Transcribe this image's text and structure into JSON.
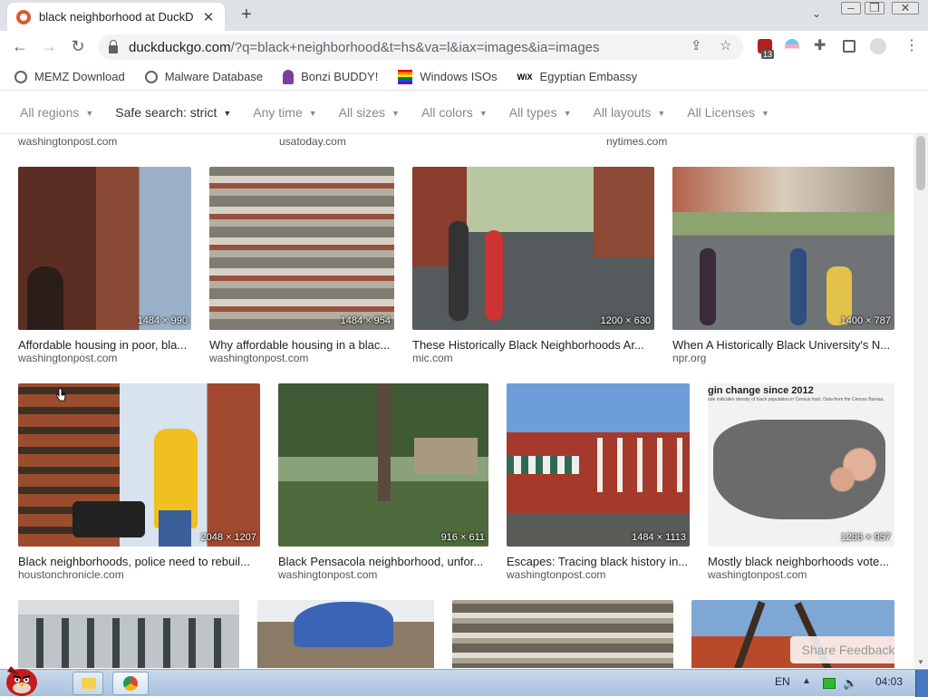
{
  "browser": {
    "tab_title": "black neighborhood at DuckD",
    "tab_close": "✕",
    "new_tab": "+",
    "url_host": "duckduckgo.com",
    "url_path": "/?q=black+neighborhood&t=hs&va=l&iax=images&ia=images",
    "extension_badge": "13"
  },
  "bookmarks": [
    {
      "label": "MEMZ Download",
      "icon": "globe-icon"
    },
    {
      "label": "Malware Database",
      "icon": "globe-icon"
    },
    {
      "label": "Bonzi BUDDY!",
      "icon": "bonzi-icon"
    },
    {
      "label": "Windows ISOs",
      "icon": "windows-icon"
    },
    {
      "label": "Egyptian Embassy",
      "icon": "wix-icon"
    }
  ],
  "filters": [
    {
      "label": "All regions",
      "active": false
    },
    {
      "label": "Safe search: strict",
      "active": true
    },
    {
      "label": "Any time",
      "active": false
    },
    {
      "label": "All sizes",
      "active": false
    },
    {
      "label": "All colors",
      "active": false
    },
    {
      "label": "All types",
      "active": false
    },
    {
      "label": "All layouts",
      "active": false
    },
    {
      "label": "All Licenses",
      "active": false
    }
  ],
  "top_sources": [
    "washingtonpost.com",
    "usatoday.com",
    "nytimes.com"
  ],
  "rows": [
    [
      {
        "title": "Affordable housing in poor, bla...",
        "source": "washingtonpost.com",
        "dims": "1484 × 990"
      },
      {
        "title": "Why affordable housing in a blac...",
        "source": "washingtonpost.com",
        "dims": "1484 × 954"
      },
      {
        "title": "These Historically Black Neighborhoods Ar...",
        "source": "mic.com",
        "dims": "1200 × 630"
      },
      {
        "title": "When A Historically Black University's N...",
        "source": "npr.org",
        "dims": "1400 × 787"
      }
    ],
    [
      {
        "title": "Black neighborhoods, police need to rebuil...",
        "source": "houstonchronicle.com",
        "dims": "2048 × 1207"
      },
      {
        "title": "Black Pensacola neighborhood, unfor...",
        "source": "washingtonpost.com",
        "dims": "916 × 611"
      },
      {
        "title": "Escapes: Tracing black history in...",
        "source": "washingtonpost.com",
        "dims": "1484 × 1113"
      },
      {
        "title": "Mostly black neighborhoods vote...",
        "source": "washingtonpost.com",
        "dims": "1296 × 957"
      }
    ]
  ],
  "map_caption": "gin change since 2012",
  "map_subcaption": "ade indicates density of black population in Census tract. Data from the Census Bureau.",
  "feedback": "Share Feedback",
  "taskbar": {
    "lang": "EN",
    "time": "04:03"
  }
}
